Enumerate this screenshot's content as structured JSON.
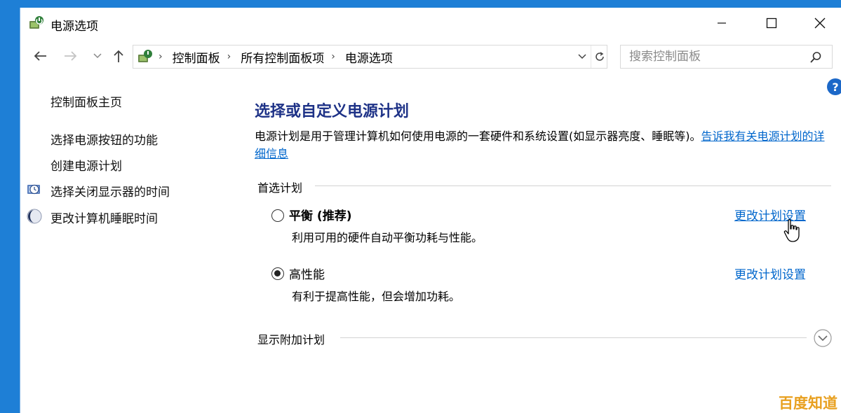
{
  "window": {
    "title": "电源选项"
  },
  "nav": {
    "breadcrumb": [
      "控制面板",
      "所有控制面板项",
      "电源选项"
    ],
    "search_placeholder": "搜索控制面板"
  },
  "sidebar": {
    "home": "控制面板主页",
    "items": [
      {
        "label": "选择电源按钮的功能",
        "icon": ""
      },
      {
        "label": "创建电源计划",
        "icon": ""
      },
      {
        "label": "选择关闭显示器的时间",
        "icon": "monitor-clock-icon"
      },
      {
        "label": "更改计算机睡眠时间",
        "icon": "moon-icon"
      }
    ]
  },
  "main": {
    "title": "选择或自定义电源计划",
    "description": "电源计划是用于管理计算机如何使用电源的一套硬件和系统设置(如显示器亮度、睡眠等)。",
    "description_link": "告诉我有关电源计划的详细信息",
    "preferred_group": "首选计划",
    "additional_group": "显示附加计划",
    "plans": [
      {
        "name": "平衡 (推荐)",
        "description": "利用可用的硬件自动平衡功耗与性能。",
        "link": "更改计划设置",
        "selected": false
      },
      {
        "name": "高性能",
        "description": "有利于提高性能，但会增加功耗。",
        "link": "更改计划设置",
        "selected": true
      }
    ]
  },
  "watermark": "百度知道",
  "colors": {
    "accent": "#0066cc",
    "title": "#1e3287",
    "desktop": "#1e7fd6",
    "watermark": "#e8a020"
  }
}
